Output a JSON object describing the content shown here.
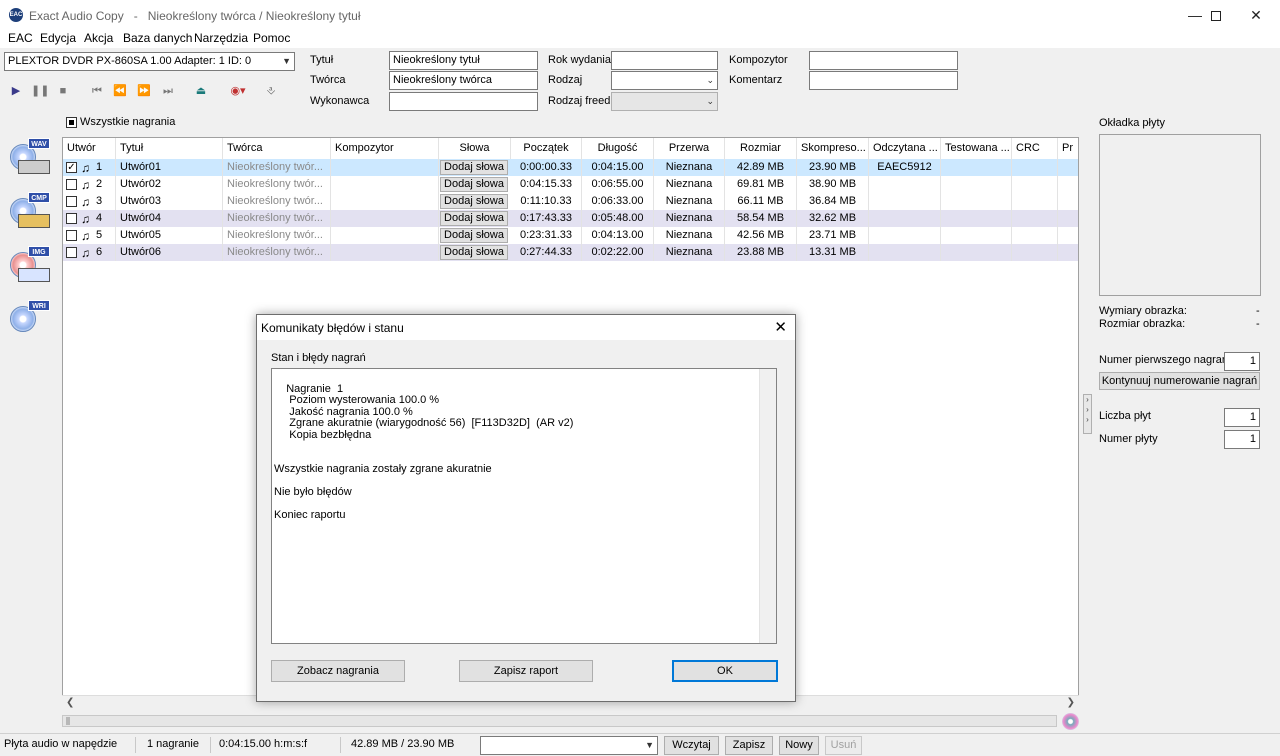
{
  "window": {
    "app_name": "Exact Audio Copy",
    "separator": "-",
    "document_title": "Nieokreślony twórca / Nieokreślony tytuł",
    "app_icon_text": "EAC"
  },
  "menu": [
    "EAC",
    "Edycja",
    "Akcja",
    "Baza danych",
    "Narzędzia",
    "Pomoc"
  ],
  "drive": {
    "selected": "PLEXTOR DVDR   PX-860SA 1.00   Adapter: 1  ID: 0"
  },
  "metadata": {
    "title_label": "Tytuł",
    "title_value": "Nieokreślony tytuł",
    "creator_label": "Twórca",
    "creator_value": "Nieokreślony twórca",
    "performer_label": "Wykonawca",
    "performer_value": "",
    "year_label": "Rok wydania",
    "year_value": "",
    "genre_label": "Rodzaj",
    "genre_value": "",
    "freedb_genre_label": "Rodzaj freedb",
    "freedb_genre_value": "",
    "composer_label": "Kompozytor",
    "composer_value": "",
    "comment_label": "Komentarz",
    "comment_value": ""
  },
  "all_tracks_label": "Wszystkie nagrania",
  "side_tags": [
    "WAV",
    "CMP",
    "IMG",
    "WRI"
  ],
  "table": {
    "columns": [
      "Utwór",
      "Tytuł",
      "Twórca",
      "Kompozytor",
      "Słowa",
      "Początek",
      "Długość",
      "Przerwa",
      "Rozmiar",
      "Skompreso...",
      "Odczytana ...",
      "Testowana ...",
      "CRC",
      "Pr"
    ],
    "lyrics_button": "Dodaj słowa",
    "rows": [
      {
        "num": "1",
        "title": "Utwór01",
        "creator": "Nieokreślony twór...",
        "start": "0:00:00.33",
        "length": "0:04:15.00",
        "gap": "Nieznana",
        "size": "42.89 MB",
        "compressed": "23.90 MB",
        "read_crc": "EAEC5912",
        "checked": true
      },
      {
        "num": "2",
        "title": "Utwór02",
        "creator": "Nieokreślony twór...",
        "start": "0:04:15.33",
        "length": "0:06:55.00",
        "gap": "Nieznana",
        "size": "69.81 MB",
        "compressed": "38.90 MB",
        "read_crc": "",
        "checked": false
      },
      {
        "num": "3",
        "title": "Utwór03",
        "creator": "Nieokreślony twór...",
        "start": "0:11:10.33",
        "length": "0:06:33.00",
        "gap": "Nieznana",
        "size": "66.11 MB",
        "compressed": "36.84 MB",
        "read_crc": "",
        "checked": false
      },
      {
        "num": "4",
        "title": "Utwór04",
        "creator": "Nieokreślony twór...",
        "start": "0:17:43.33",
        "length": "0:05:48.00",
        "gap": "Nieznana",
        "size": "58.54 MB",
        "compressed": "32.62 MB",
        "read_crc": "",
        "checked": false
      },
      {
        "num": "5",
        "title": "Utwór05",
        "creator": "Nieokreślony twór...",
        "start": "0:23:31.33",
        "length": "0:04:13.00",
        "gap": "Nieznana",
        "size": "42.56 MB",
        "compressed": "23.71 MB",
        "read_crc": "",
        "checked": false
      },
      {
        "num": "6",
        "title": "Utwór06",
        "creator": "Nieokreślony twór...",
        "start": "0:27:44.33",
        "length": "0:02:22.00",
        "gap": "Nieznana",
        "size": "23.88 MB",
        "compressed": "13.31 MB",
        "read_crc": "",
        "checked": false
      }
    ]
  },
  "right_panel": {
    "cover_label": "Okładka płyty",
    "image_dims_label": "Wymiary obrazka:",
    "image_dims_value": "-",
    "image_size_label": "Rozmiar obrazka:",
    "image_size_value": "-",
    "first_track_label": "Numer pierwszego nagrania:",
    "first_track_value": "1",
    "continue_numbering_button": "Kontynuuj numerowanie nagrań",
    "disc_count_label": "Liczba płyt",
    "disc_count_value": "1",
    "disc_number_label": "Numer płyty",
    "disc_number_value": "1"
  },
  "dialog": {
    "title": "Komunikaty błędów i stanu",
    "section_label": "Stan i błędy nagrań",
    "report": "Nagranie  1\n     Poziom wysterowania 100.0 %\n     Jakość nagrania 100.0 %\n     Zgrane akuratnie (wiarygodność 56)  [F113D32D]  (AR v2)\n     Kopia bezbłędna\n\n\nWszystkie nagrania zostały zgrane akuratnie\n\nNie było błędów\n\nKoniec raportu",
    "view_tracks_button": "Zobacz nagrania",
    "save_report_button": "Zapisz raport",
    "ok_button": "OK"
  },
  "statusbar": {
    "disc_status": "Płyta audio w napędzie",
    "track_count": "1 nagranie",
    "duration": "0:04:15.00 h:m:s:f",
    "sizes": "42.89 MB  /  23.90 MB",
    "load_button": "Wczytaj",
    "save_button": "Zapisz",
    "new_button": "Nowy",
    "delete_button": "Usuń"
  }
}
